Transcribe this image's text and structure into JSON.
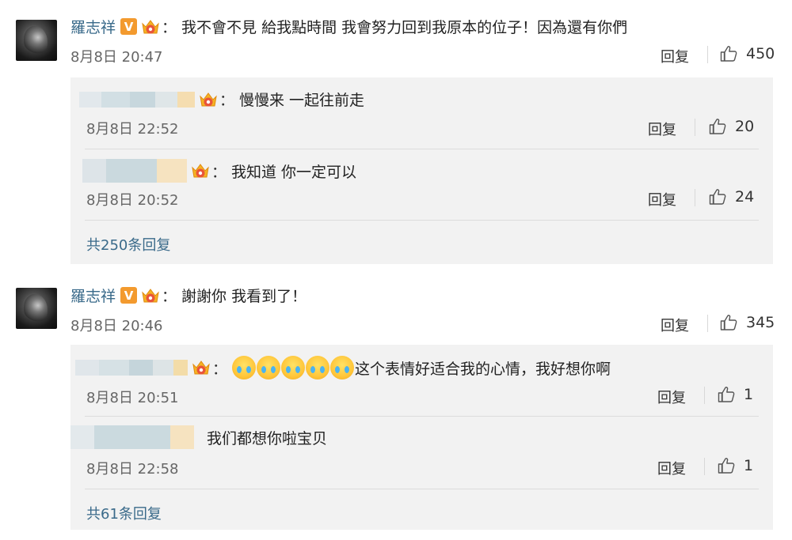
{
  "comments": [
    {
      "user": "羅志祥",
      "text": "我不會不見 給我點時間 我會努力回到我原本的位子！因為還有你們",
      "time": "8月8日 20:47",
      "reply": "回复",
      "likes": "450",
      "replies": [
        {
          "text": "慢慢来 一起往前走",
          "time": "8月8日 22:52",
          "reply": "回复",
          "likes": "20"
        },
        {
          "text": "我知道 你一定可以",
          "time": "8月8日 20:52",
          "reply": "回复",
          "likes": "24"
        }
      ],
      "total": "共250条回复"
    },
    {
      "user": "羅志祥",
      "text": "謝謝你 我看到了！",
      "time": "8月8日 20:46",
      "reply": "回复",
      "likes": "345",
      "replies": [
        {
          "text": "这个表情好适合我的心情，我好想你啊",
          "time": "8月8日 20:51",
          "reply": "回复",
          "likes": "1"
        },
        {
          "text": "我们都想你啦宝贝",
          "time": "8月8日 22:58",
          "reply": "回复",
          "likes": "1"
        }
      ],
      "total": "共61条回复"
    }
  ],
  "badge_v": "V",
  "colon": "：",
  "colors": {
    "link": "#3a6a8a",
    "badge": "#f39a2e",
    "subbox": "#f2f2f2"
  },
  "icons": {
    "like": "thumbs-up-icon",
    "crown": "crown-badge-icon",
    "emoji": "crying-face-emoji"
  }
}
